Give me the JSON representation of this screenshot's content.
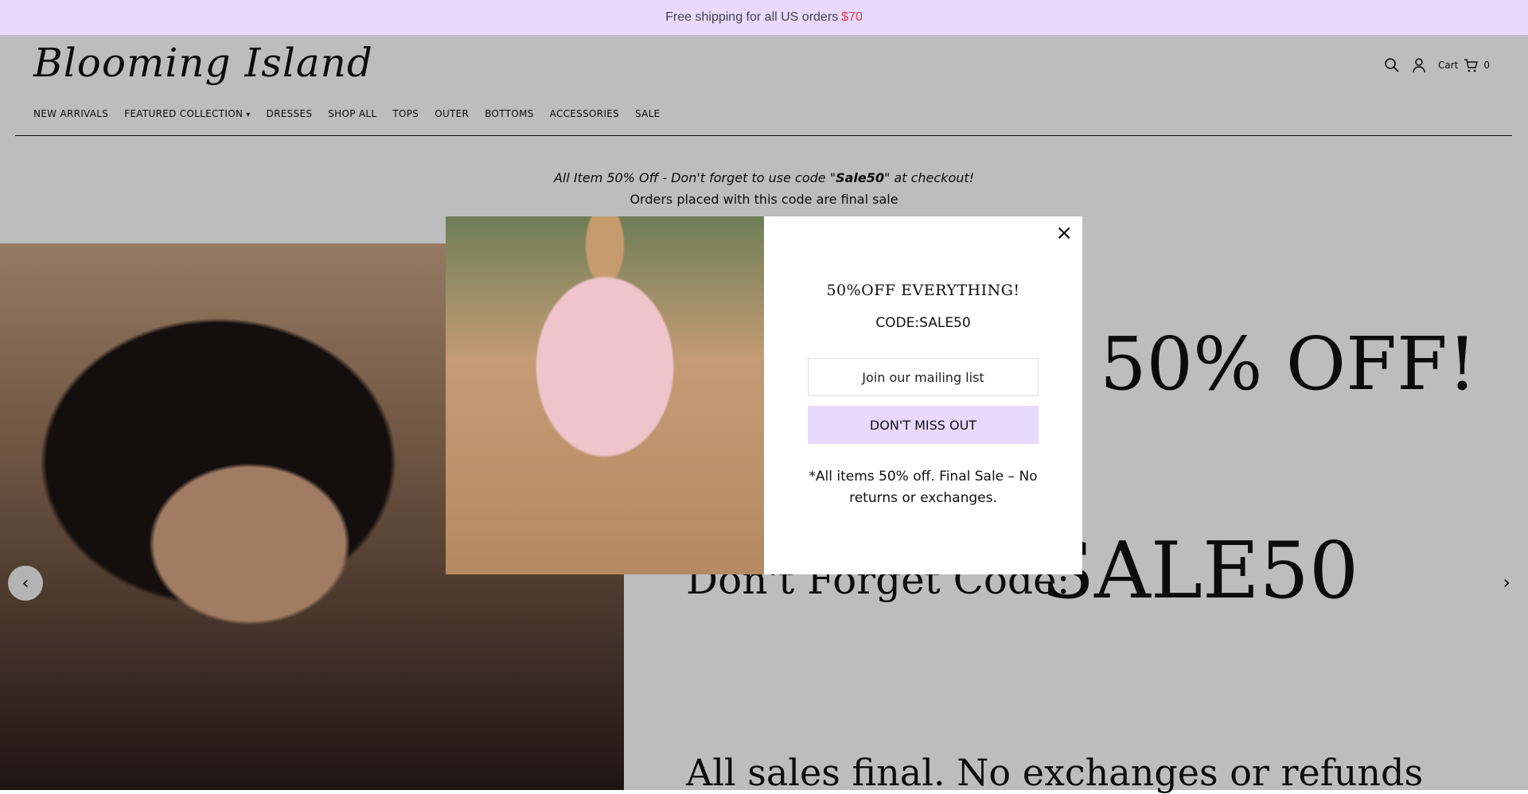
{
  "announcement": {
    "text": "Free shipping for all US orders",
    "amount": "$70"
  },
  "header": {
    "logo": "Blooming Island",
    "cart_label": "Cart",
    "cart_count": "0",
    "nav": [
      "NEW ARRIVALS",
      "FEATURED COLLECTION",
      "DRESSES",
      "SHOP ALL",
      "TOPS",
      "OUTER",
      "BOTTOMS",
      "ACCESSORIES",
      "SALE"
    ]
  },
  "promo": {
    "line1_prefix": "All Item 50% Off - Don't forget to use code \"",
    "line1_code": "Sale50",
    "line1_suffix": "\" at checkout!",
    "line2": "Orders placed with this code are final sale"
  },
  "hero": {
    "off_text": "50% OFF!",
    "code_label": "Don't Forget Code:",
    "code_value": "SALE50",
    "final_text": "All sales final. No exchanges or refunds"
  },
  "modal": {
    "close": "×",
    "headline": "50%OFF EVERYTHING!",
    "code": "CODE:SALE50",
    "input_placeholder": "Join our mailing list",
    "button_label": "DON'T MISS OUT",
    "note": "*All items 50% off. Final Sale – No returns or exchanges."
  },
  "colors": {
    "accent": "#e9d9ff",
    "price": "#e0434b"
  }
}
